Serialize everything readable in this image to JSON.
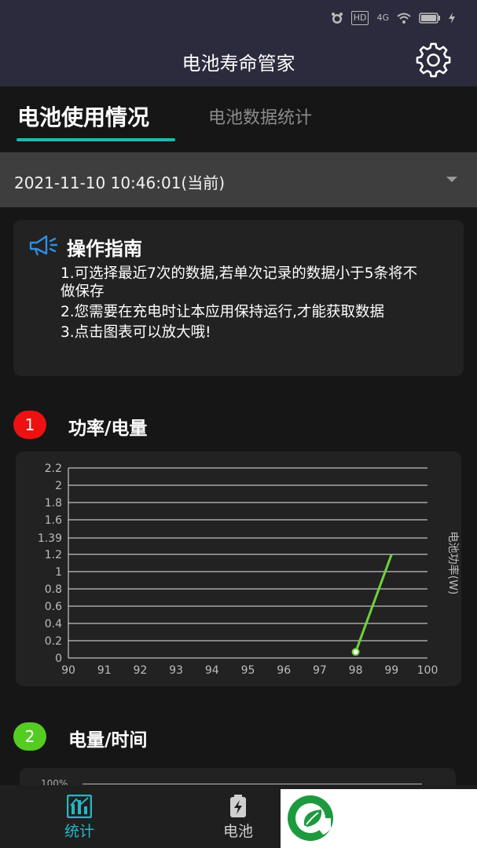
{
  "status_bar": {
    "icons": [
      "alarm-icon",
      "hd-icon",
      "4g-signal-icon",
      "wifi-icon",
      "battery-icon",
      "charging-icon"
    ],
    "labels": {
      "hd": "HD",
      "net": "4G"
    }
  },
  "app_bar": {
    "title": "电池寿命管家",
    "settings_icon": "gear-icon"
  },
  "tabs": [
    {
      "label": "电池使用情况",
      "active": true
    },
    {
      "label": "电池数据统计",
      "active": false
    }
  ],
  "record_select": {
    "value": "2021-11-10 10:46:01(当前)"
  },
  "guide": {
    "title": "操作指南",
    "items": [
      "1.可选择最近7次的数据,若单次记录的数据小于5条将不做保存",
      "2.您需要在充电时让本应用保持运行,才能获取数据",
      "3.点击图表可以放大哦!"
    ]
  },
  "section1": {
    "badge": "1",
    "title": "功率/电量",
    "badge_color": "#ee1111"
  },
  "section2": {
    "badge": "2",
    "title": "电量/时间",
    "badge_color": "#55cc22",
    "first_tick": "100%"
  },
  "chart_data": {
    "type": "line",
    "title": "",
    "xlabel": "",
    "ylabel": "电池功率(W)",
    "x_ticks": [
      "90",
      "91",
      "92",
      "93",
      "94",
      "95",
      "96",
      "97",
      "98",
      "99",
      "100"
    ],
    "y_ticks": [
      "0",
      "0.2",
      "0.4",
      "0.6",
      "0.8",
      "1",
      "1.2",
      "1.39",
      "1.6",
      "1.8",
      "2",
      "2.2"
    ],
    "xlim": [
      90,
      100
    ],
    "ylim": [
      0,
      2.2
    ],
    "grid": true,
    "series": [
      {
        "x": [
          98,
          99
        ],
        "y": [
          0.07,
          1.2
        ],
        "color": "#6ed23a"
      }
    ]
  },
  "bottom_nav": [
    {
      "label": "统计",
      "icon": "chart-icon",
      "active": true,
      "color": "#27b6c6"
    },
    {
      "label": "电池",
      "icon": "battery-charge-icon",
      "active": false,
      "color": "#cfcfcf"
    }
  ],
  "colors": {
    "accent": "#27b6b0",
    "bar": "#2c2b3d",
    "line": "#6ed23a"
  }
}
